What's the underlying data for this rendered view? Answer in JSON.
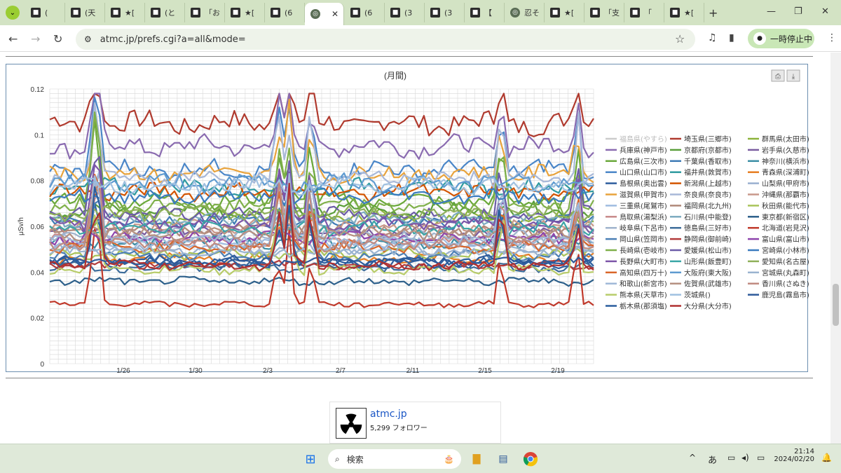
{
  "browser": {
    "tabs": [
      {
        "label": "(",
        "icon": "favicon"
      },
      {
        "label": "(天",
        "icon": "favicon"
      },
      {
        "label": "★[",
        "icon": "favicon"
      },
      {
        "label": "(と",
        "icon": "favicon"
      },
      {
        "label": "「お",
        "icon": "favicon"
      },
      {
        "label": "★[",
        "icon": "favicon"
      },
      {
        "label": "(6",
        "icon": "favicon"
      },
      {
        "label": "",
        "icon": "globe",
        "active": true
      },
      {
        "label": "(6",
        "icon": "favicon"
      },
      {
        "label": "(3",
        "icon": "favicon"
      },
      {
        "label": "(3",
        "icon": "favicon"
      },
      {
        "label": "【",
        "icon": "favicon"
      },
      {
        "label": "忍そ",
        "icon": "globe"
      },
      {
        "label": "★[",
        "icon": "favicon"
      },
      {
        "label": "「支",
        "icon": "favicon"
      },
      {
        "label": "「",
        "icon": "favicon"
      },
      {
        "label": "★[",
        "icon": "favicon"
      }
    ],
    "url": "atmc.jp/prefs.cgi?a=all&mode=",
    "pause_label": "一時停止中"
  },
  "chart_data": {
    "type": "line",
    "title": "(月間)",
    "ylabel": "μSv/h",
    "ylim": [
      0,
      0.12
    ],
    "yticks": [
      "0",
      "0.02",
      "0.04",
      "0.06",
      "0.08",
      "0.1",
      "0.12"
    ],
    "xticks": [
      "1/26",
      "1/30",
      "2/3",
      "2/7",
      "2/11",
      "2/15",
      "2/19"
    ],
    "grid": true,
    "legend_position": "right",
    "series": [
      {
        "name": "福島県(やすら)",
        "color": "#b0b0b0",
        "base": 0,
        "hidden": true
      },
      {
        "name": "埼玉県(三郷市)",
        "color": "#b03a2e",
        "base": 0.105
      },
      {
        "name": "群馬県(太田市)",
        "color": "#8db33a",
        "base": 0.064
      },
      {
        "name": "兵庫県(神戸市)",
        "color": "#8a6bb0",
        "base": 0.095
      },
      {
        "name": "京都府(京都市)",
        "color": "#5a9e3a",
        "base": 0.067
      },
      {
        "name": "岩手県(久慈市)",
        "color": "#7a5ca0",
        "base": 0.058
      },
      {
        "name": "広島県(三次市)",
        "color": "#6aa83a",
        "base": 0.071
      },
      {
        "name": "千葉県(香取市)",
        "color": "#3d7ab5",
        "base": 0.062
      },
      {
        "name": "神奈川(横浜市)",
        "color": "#3b8ea5",
        "base": 0.053
      },
      {
        "name": "山口県(山口市)",
        "color": "#4a86c8",
        "base": 0.085
      },
      {
        "name": "福井県(敦賀市)",
        "color": "#2f9aa0",
        "base": 0.077
      },
      {
        "name": "青森県(深浦町)",
        "color": "#e67e22",
        "base": 0.046
      },
      {
        "name": "島根県(奥出雲)",
        "color": "#2e5e9e",
        "base": 0.044
      },
      {
        "name": "新潟県(上越市)",
        "color": "#d35400",
        "base": 0.075
      },
      {
        "name": "山梨県(甲府市)",
        "color": "#9ab0d0",
        "base": 0.05
      },
      {
        "name": "滋賀県(甲賀市)",
        "color": "#e8a33c",
        "base": 0.083
      },
      {
        "name": "奈良県(奈良市)",
        "color": "#a8b8d8",
        "base": 0.081
      },
      {
        "name": "沖縄県(那覇市)",
        "color": "#c9988a",
        "base": 0.06
      },
      {
        "name": "三重県(尾鷲市)",
        "color": "#9fbce0",
        "base": 0.052
      },
      {
        "name": "福岡県(北九州)",
        "color": "#b08878",
        "base": 0.058
      },
      {
        "name": "秋田県(能代市)",
        "color": "#a9c45a",
        "base": 0.048
      },
      {
        "name": "鳥取県(湯梨浜)",
        "color": "#c88a8a",
        "base": 0.054
      },
      {
        "name": "石川県(中能登)",
        "color": "#7cabc0",
        "base": 0.063
      },
      {
        "name": "東京都(新宿区)",
        "color": "#2c5f8a",
        "base": 0.036
      },
      {
        "name": "岐阜県(下呂市)",
        "color": "#9fb3cc",
        "base": 0.056
      },
      {
        "name": "徳島県(三好市)",
        "color": "#3d6c9a",
        "base": 0.042
      },
      {
        "name": "北海道(岩見沢)",
        "color": "#c0392b",
        "base": 0.026
      },
      {
        "name": "岡山県(笠岡市)",
        "color": "#4b7fb5",
        "base": 0.047
      },
      {
        "name": "静岡県(御前崎)",
        "color": "#b33b3b",
        "base": 0.043
      },
      {
        "name": "富山県(富山市)",
        "color": "#8e44ad",
        "base": 0.055
      },
      {
        "name": "長崎県(壱岐市)",
        "color": "#7fb04a",
        "base": 0.069
      },
      {
        "name": "愛媛県(松山市)",
        "color": "#6c5ca8",
        "base": 0.065
      },
      {
        "name": "宮崎県(小林市)",
        "color": "#3a7bbf",
        "base": 0.073
      },
      {
        "name": "長野県(大町市)",
        "color": "#7d55a8",
        "base": 0.061
      },
      {
        "name": "山形県(飯豊町)",
        "color": "#3aa6a6",
        "base": 0.059
      },
      {
        "name": "愛知県(名古屋)",
        "color": "#8fb05a",
        "base": 0.066
      },
      {
        "name": "高知県(四万十)",
        "color": "#d9662a",
        "base": 0.051
      },
      {
        "name": "大阪府(東大阪)",
        "color": "#5f9bd0",
        "base": 0.079
      },
      {
        "name": "宮城県(丸森町)",
        "color": "#9ab4d0",
        "base": 0.049
      },
      {
        "name": "和歌山(新宮市)",
        "color": "#a0b8d8",
        "base": 0.054
      },
      {
        "name": "佐賀県(武雄市)",
        "color": "#b59080",
        "base": 0.057
      },
      {
        "name": "香川県(さぬき)",
        "color": "#c08a80",
        "base": 0.052
      },
      {
        "name": "熊本県(天草市)",
        "color": "#b8cc6a",
        "base": 0.041
      },
      {
        "name": "茨城県()",
        "color": "#9fc0e0",
        "base": 0.078
      },
      {
        "name": "鹿児島(霧島市)",
        "color": "#2e5a9a",
        "base": 0.045
      },
      {
        "name": "栃木県(那須塩)",
        "color": "#2b5e9e",
        "base": 0.044
      },
      {
        "name": "大分県(大分市)",
        "color": "#b03030",
        "base": 0.043
      }
    ]
  },
  "follow_card": {
    "name": "atmc.jp",
    "followers": "5,299 フォロワー"
  },
  "taskbar": {
    "search_placeholder": "検索",
    "ime": "あ",
    "time": "21:14",
    "date": "2024/02/20"
  }
}
